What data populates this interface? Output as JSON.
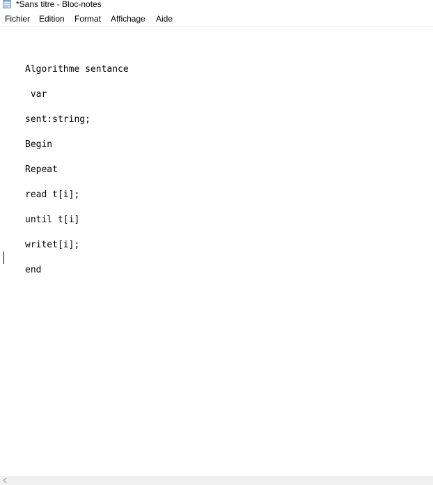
{
  "window": {
    "title": "*Sans titre - Bloc-notes",
    "app_icon": "notepad-icon"
  },
  "menu": {
    "items": [
      {
        "label": "Fichier"
      },
      {
        "label": "Edition"
      },
      {
        "label": "Format"
      },
      {
        "label": "Affichage"
      },
      {
        "label": "Aide"
      }
    ]
  },
  "editor": {
    "lines": [
      "Algorithme sentance",
      " var",
      "sent:string;",
      "Begin",
      "Repeat",
      "read t[i];",
      "until t[i]",
      "writet[i];",
      "end"
    ]
  },
  "scrollbar": {
    "left_arrow_icon": "chevron-left-icon"
  }
}
